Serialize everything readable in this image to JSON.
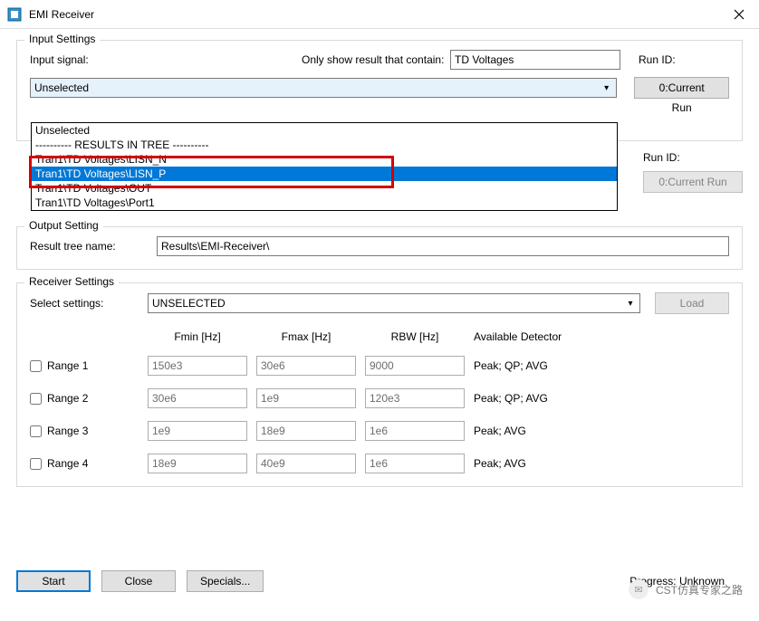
{
  "window": {
    "title": "EMI Receiver"
  },
  "input_settings": {
    "legend": "Input Settings",
    "input_signal_label": "Input signal:",
    "filter_label": "Only show result that contain:",
    "filter_value": "TD Voltages",
    "run_id_label": "Run ID:",
    "run_id_btn": "0:Current Run",
    "run_id_label2": "Run ID:",
    "run_id_btn2": "0:Current Run",
    "combo_value": "Unselected",
    "dropdown_items": [
      "Unselected",
      "---------- RESULTS IN TREE ----------",
      "Tran1\\TD Voltages\\LISN_N",
      "Tran1\\TD Voltages\\LISN_P",
      "Tran1\\TD Voltages\\OUT",
      "Tran1\\TD Voltages\\Port1"
    ],
    "highlight_index": 3
  },
  "output_setting": {
    "legend": "Output Setting",
    "result_tree_label": "Result tree name:",
    "result_tree_value": "Results\\EMI-Receiver\\"
  },
  "receiver_settings": {
    "legend": "Receiver Settings",
    "select_label": "Select settings:",
    "select_value": "UNSELECTED",
    "load_btn": "Load",
    "headers": {
      "fmin": "Fmin [Hz]",
      "fmax": "Fmax [Hz]",
      "rbw": "RBW [Hz]",
      "det": "Available Detector"
    },
    "rows": [
      {
        "label": "Range 1",
        "fmin": "150e3",
        "fmax": "30e6",
        "rbw": "9000",
        "det": "Peak; QP; AVG"
      },
      {
        "label": "Range 2",
        "fmin": "30e6",
        "fmax": "1e9",
        "rbw": "120e3",
        "det": "Peak; QP; AVG"
      },
      {
        "label": "Range 3",
        "fmin": "1e9",
        "fmax": "18e9",
        "rbw": "1e6",
        "det": "Peak; AVG"
      },
      {
        "label": "Range 4",
        "fmin": "18e9",
        "fmax": "40e9",
        "rbw": "1e6",
        "det": "Peak; AVG"
      }
    ]
  },
  "footer": {
    "start": "Start",
    "close": "Close",
    "specials": "Specials...",
    "progress": "Progress: Unknown"
  },
  "watermark": "CST仿真专家之路"
}
